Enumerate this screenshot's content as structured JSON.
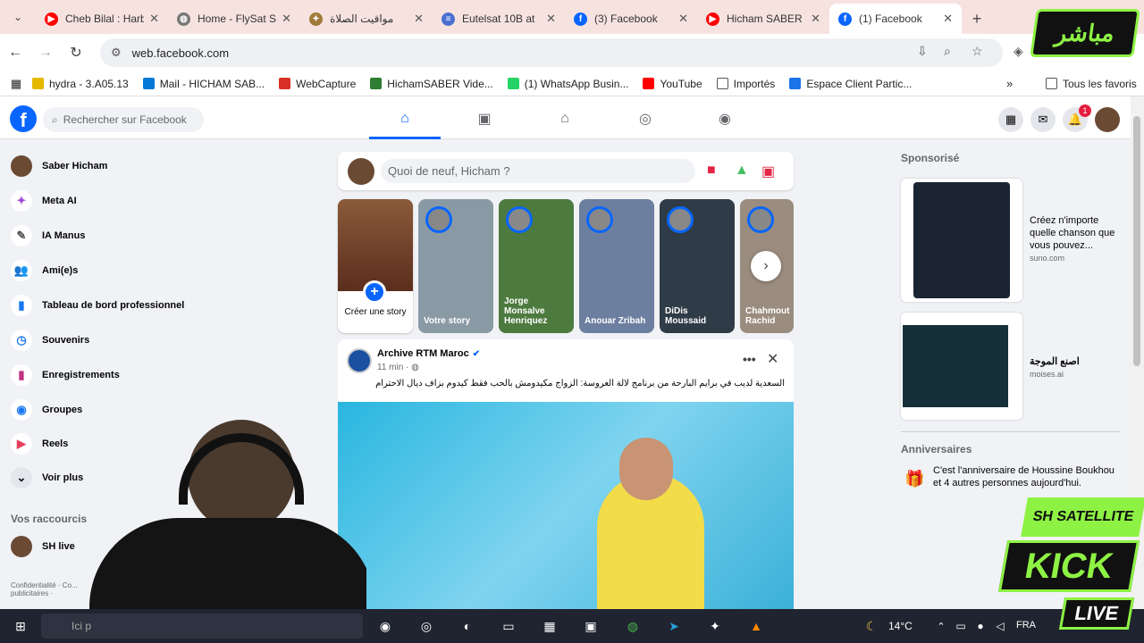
{
  "browser": {
    "tabs": [
      {
        "label": "Cheb Bilal : Harb",
        "icon": "youtube-icon",
        "color": "#ff0000",
        "active": false
      },
      {
        "label": "Home - FlySat S",
        "icon": "globe-icon",
        "color": "#777777",
        "active": false
      },
      {
        "label": "مواقيت الصلاة",
        "icon": "emblem-icon",
        "color": "#a07a3a",
        "active": false
      },
      {
        "label": "Eutelsat 10B at",
        "icon": "document-icon",
        "color": "#4a6fcf",
        "active": false
      },
      {
        "label": "(3) Facebook",
        "icon": "facebook-icon",
        "color": "#0866ff",
        "active": false
      },
      {
        "label": "Hicham SABER",
        "icon": "youtube-icon",
        "color": "#ff0000",
        "active": false
      },
      {
        "label": "(1) Facebook",
        "icon": "facebook-icon",
        "color": "#0866ff",
        "active": true
      }
    ],
    "url": "web.facebook.com",
    "bookmarks": [
      "hydra - 3.A05.13",
      "Mail - HICHAM SAB...",
      "WebCapture",
      "HichamSABER Vide...",
      "(1) WhatsApp Busin...",
      "YouTube",
      "Importés",
      "Espace Client Partic..."
    ],
    "all_bookmarks": "Tous les favoris"
  },
  "facebook": {
    "logo": "f",
    "search_placeholder": "Rechercher sur Facebook",
    "notif_count": "1",
    "left_nav": [
      {
        "label": "Saber Hicham",
        "icon": "avatar-icon"
      },
      {
        "label": "Meta AI",
        "icon": "meta-ai-icon"
      },
      {
        "label": "IA Manus",
        "icon": "manus-icon"
      },
      {
        "label": "Ami(e)s",
        "icon": "friends-icon"
      },
      {
        "label": "Tableau de bord professionnel",
        "icon": "dashboard-icon"
      },
      {
        "label": "Souvenirs",
        "icon": "memories-icon"
      },
      {
        "label": "Enregistrements",
        "icon": "bookmark-icon"
      },
      {
        "label": "Groupes",
        "icon": "groups-icon"
      },
      {
        "label": "Reels",
        "icon": "reels-icon"
      },
      {
        "label": "Voir plus",
        "icon": "chevron-down-icon"
      }
    ],
    "shortcuts_title": "Vos raccourcis",
    "shortcut": "SH live",
    "footer": "Confidentialité · Co... publicitaires ·",
    "composer_placeholder": "Quoi de neuf, Hicham ?",
    "stories": [
      {
        "name": "Créer une story"
      },
      {
        "name": "Votre story"
      },
      {
        "name": "Jorge Monsalve Henriquez"
      },
      {
        "name": "Anouar Zribah"
      },
      {
        "name": "DiDis Moussaid"
      },
      {
        "name": "Chahmout Rachid"
      }
    ],
    "post": {
      "author": "Archive RTM Maroc",
      "time": "11 min ·",
      "text": "السعدية لديب في برايم البارحة من برنامج لالة العروسة: الزواج مكيدومش بالحب فقط كيدوم بزاف ديال الاحترام"
    },
    "sponsored_title": "Sponsorisé",
    "ads": [
      {
        "text": "Créez n'importe quelle chanson que vous pouvez...",
        "domain": "suno.com"
      },
      {
        "text": "اصنع الموجة",
        "domain": "moises.ai"
      }
    ],
    "birthdays_title": "Anniversaires",
    "birthday_text": "C'est l'anniversaire de Houssine Boukhou et 4 autres personnes aujourd'hui."
  },
  "taskbar": {
    "search": "Ici p",
    "weather": "14°C",
    "lang": "FRA"
  },
  "overlay": {
    "live_tag": "مباشر",
    "brand": "SH SATELLITE",
    "kick": "KICK",
    "live": "LIVE"
  }
}
